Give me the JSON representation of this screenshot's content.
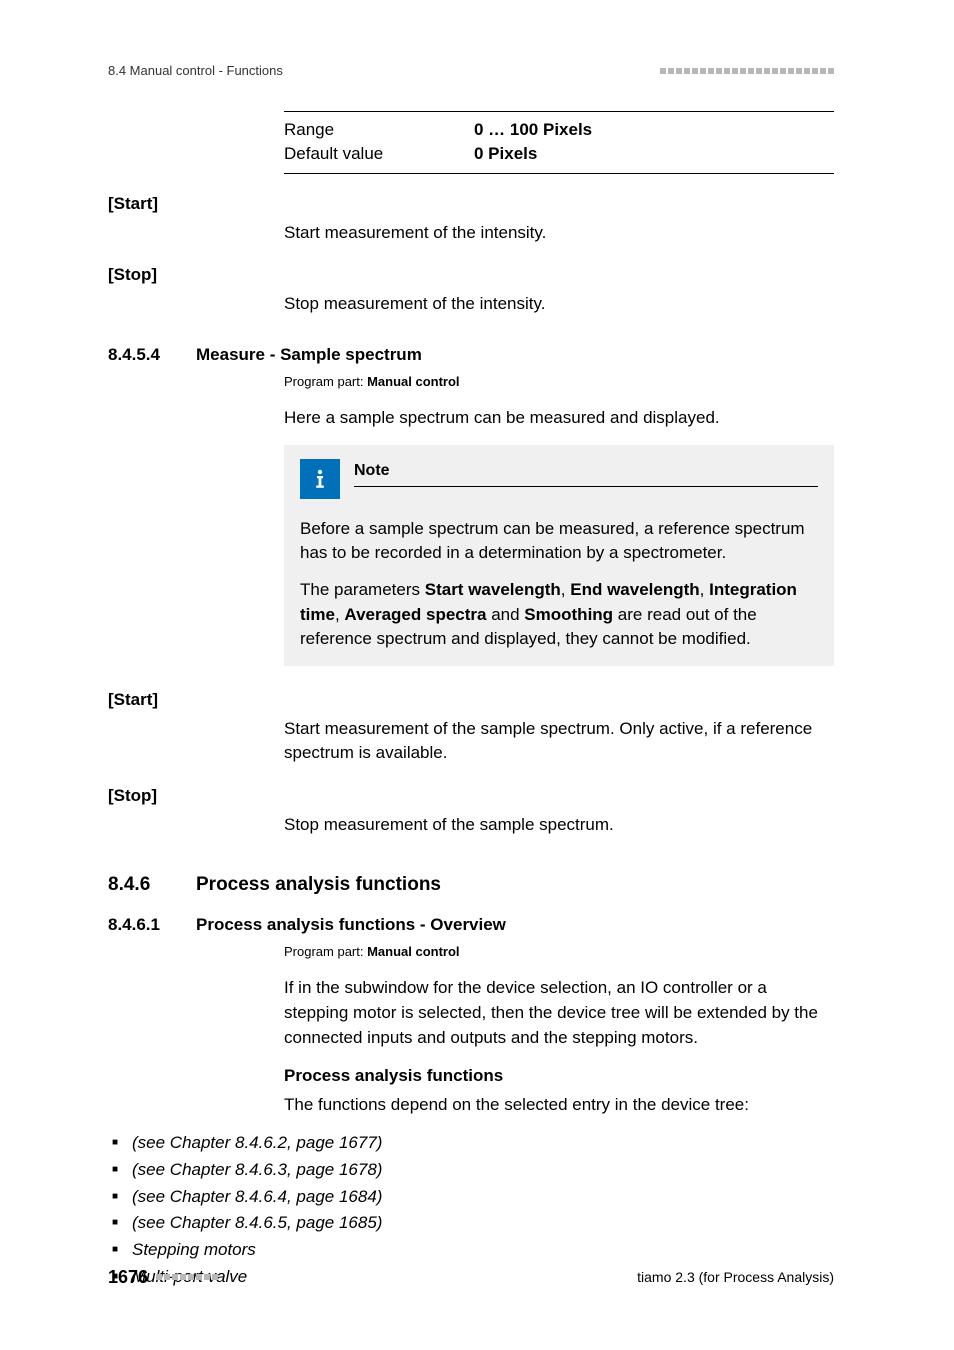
{
  "header": {
    "section_label": "8.4 Manual control - Functions"
  },
  "table": {
    "range_label": "Range",
    "range_value": "0 … 100 Pixels",
    "default_label": "Default value",
    "default_value": "0 Pixels"
  },
  "start1": {
    "term": "[Start]",
    "body": "Start measurement of the intensity."
  },
  "stop1": {
    "term": "[Stop]",
    "body": "Stop measurement of the intensity."
  },
  "sec8454": {
    "num": "8.4.5.4",
    "title": "Measure - Sample spectrum",
    "program_prefix": "Program part: ",
    "program_bold": "Manual control",
    "intro": "Here a sample spectrum can be measured and displayed."
  },
  "note": {
    "title": "Note",
    "p1": "Before a sample spectrum can be measured, a reference spectrum has to be recorded in a determination by a spectrometer.",
    "p2_a": "The parameters ",
    "p2_b1": "Start wavelength",
    "p2_c1": ", ",
    "p2_b2": "End wavelength",
    "p2_c2": ", ",
    "p2_b3": "Integration time",
    "p2_c3": ", ",
    "p2_b4": "Averaged spectra",
    "p2_c4": " and ",
    "p2_b5": "Smoothing",
    "p2_d": " are read out of the reference spectrum and displayed, they cannot be modified."
  },
  "start2": {
    "term": "[Start]",
    "body": "Start measurement of the sample spectrum. Only active, if a reference spectrum is available."
  },
  "stop2": {
    "term": "[Stop]",
    "body": "Stop measurement of the sample spectrum."
  },
  "sec846": {
    "num": "8.4.6",
    "title": "Process analysis functions"
  },
  "sec8461": {
    "num": "8.4.6.1",
    "title": "Process analysis functions - Overview",
    "program_prefix": "Program part: ",
    "program_bold": "Manual control",
    "intro": "If in the subwindow for the device selection, an IO controller or a stepping motor is selected, then the device tree will be extended by the connected inputs and outputs and the stepping motors.",
    "subhead": "Process analysis functions",
    "subintro": "The functions depend on the selected entry in the device tree:",
    "items": [
      "(see Chapter 8.4.6.2, page 1677)",
      "(see Chapter 8.4.6.3, page 1678)",
      "(see Chapter 8.4.6.4, page 1684)",
      "(see Chapter 8.4.6.5, page 1685)",
      "Stepping motors",
      "Multi-port valve"
    ]
  },
  "footer": {
    "page": "1676",
    "right": "tiamo 2.3 (for Process Analysis)"
  }
}
